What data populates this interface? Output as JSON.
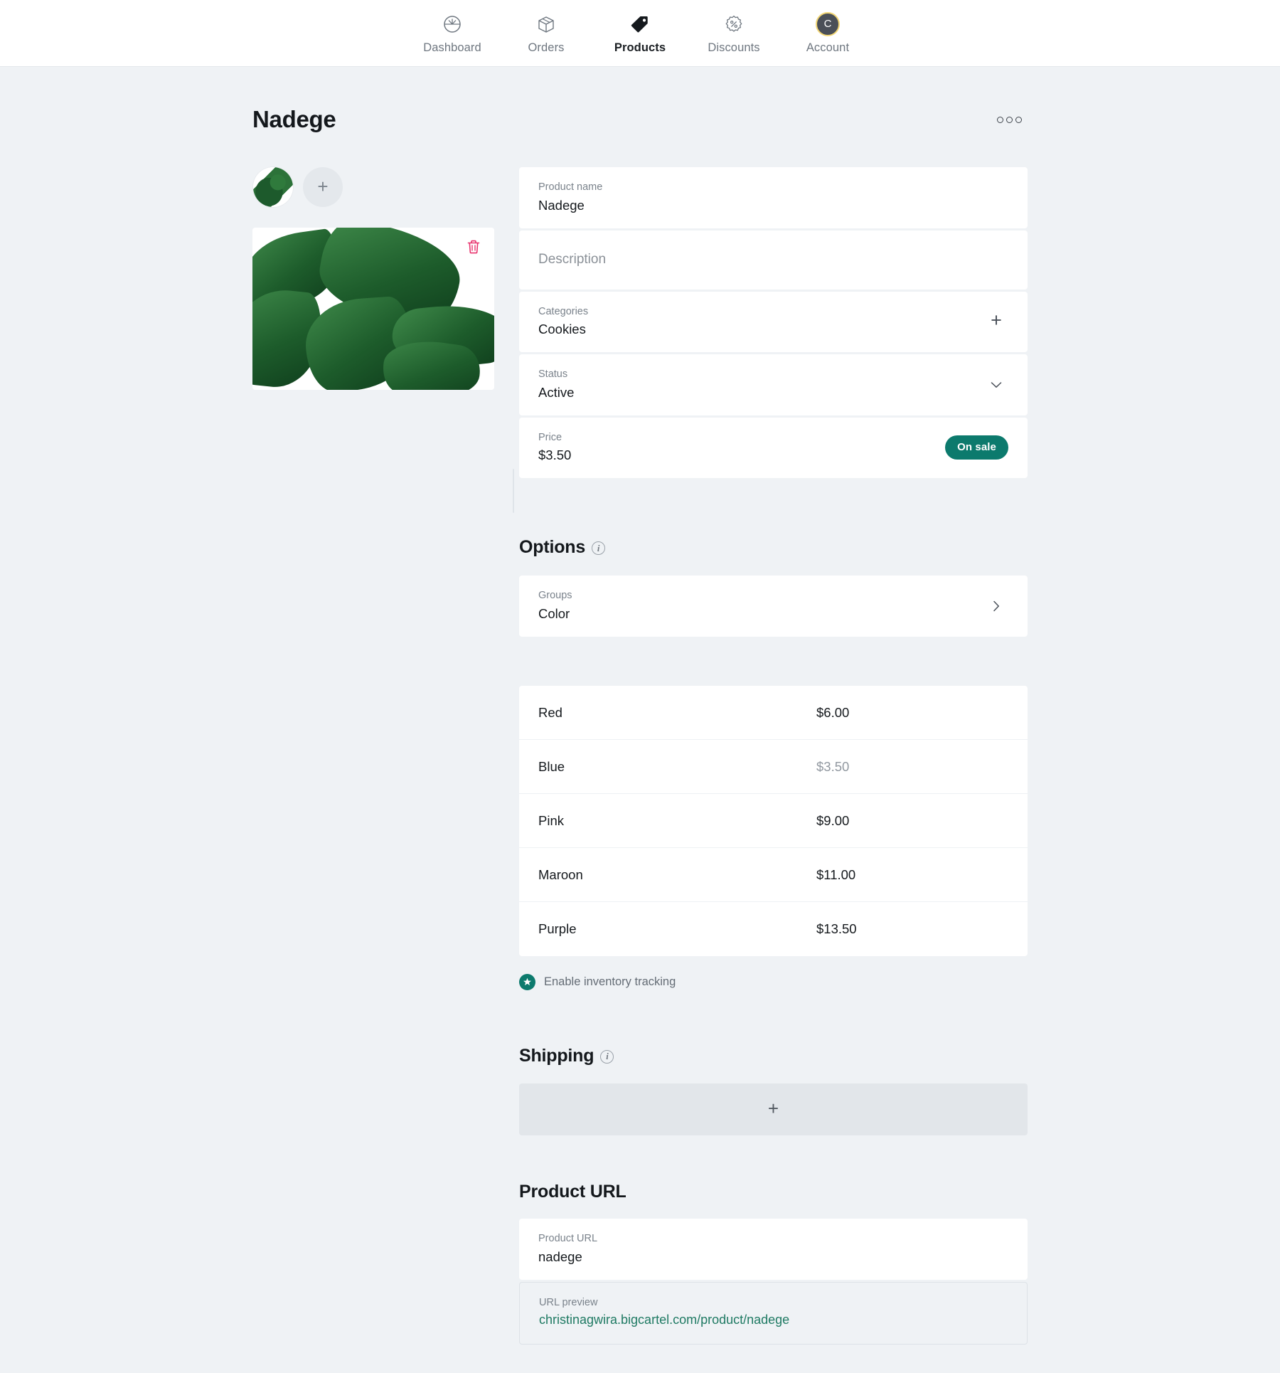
{
  "nav": {
    "items": [
      {
        "label": "Dashboard",
        "icon": "gauge-icon",
        "active": false
      },
      {
        "label": "Orders",
        "icon": "box-icon",
        "active": false
      },
      {
        "label": "Products",
        "icon": "tag-icon",
        "active": true
      },
      {
        "label": "Discounts",
        "icon": "percent-badge-icon",
        "active": false
      },
      {
        "label": "Account",
        "icon": "avatar-icon",
        "active": false
      }
    ],
    "account_initial": "C"
  },
  "header": {
    "title": "Nadege",
    "menu_icon": "kebab-menu-icon"
  },
  "media": {
    "thumb_alt": "leaf-thumbnail",
    "add_label": "+",
    "delete_icon": "trash-icon"
  },
  "form": {
    "product_name": {
      "label": "Product name",
      "value": "Nadege"
    },
    "description": {
      "label": "Description",
      "placeholder": "Description",
      "value": ""
    },
    "categories": {
      "label": "Categories",
      "value": "Cookies",
      "action": "+"
    },
    "status": {
      "label": "Status",
      "value": "Active",
      "action": "chevron-down"
    },
    "price": {
      "label": "Price",
      "value": "$3.50",
      "badge": "On sale"
    }
  },
  "options": {
    "heading": "Options",
    "groups": {
      "label": "Groups",
      "value": "Color"
    },
    "columns": [
      "name",
      "price"
    ],
    "rows": [
      {
        "name": "Red",
        "price": "$6.00",
        "muted": false
      },
      {
        "name": "Blue",
        "price": "$3.50",
        "muted": true
      },
      {
        "name": "Pink",
        "price": "$9.00",
        "muted": false
      },
      {
        "name": "Maroon",
        "price": "$11.00",
        "muted": false
      },
      {
        "name": "Purple",
        "price": "$13.50",
        "muted": false
      }
    ],
    "inventory": {
      "label": "Enable inventory tracking",
      "checked": true
    }
  },
  "shipping": {
    "heading": "Shipping",
    "add_label": "+"
  },
  "product_url": {
    "heading": "Product URL",
    "field": {
      "label": "Product URL",
      "value": "nadege"
    },
    "preview": {
      "label": "URL preview",
      "value": "christinagwira.bigcartel.com/product/nadege"
    }
  },
  "colors": {
    "page_bg": "#eff2f5",
    "card_bg": "#ffffff",
    "accent_teal": "#0c7a6d",
    "link_green": "#1f7a63",
    "trash_pink": "#e8326d",
    "avatar_ring": "#f2d675",
    "text_primary": "#15191d",
    "text_muted": "#7a828b"
  }
}
